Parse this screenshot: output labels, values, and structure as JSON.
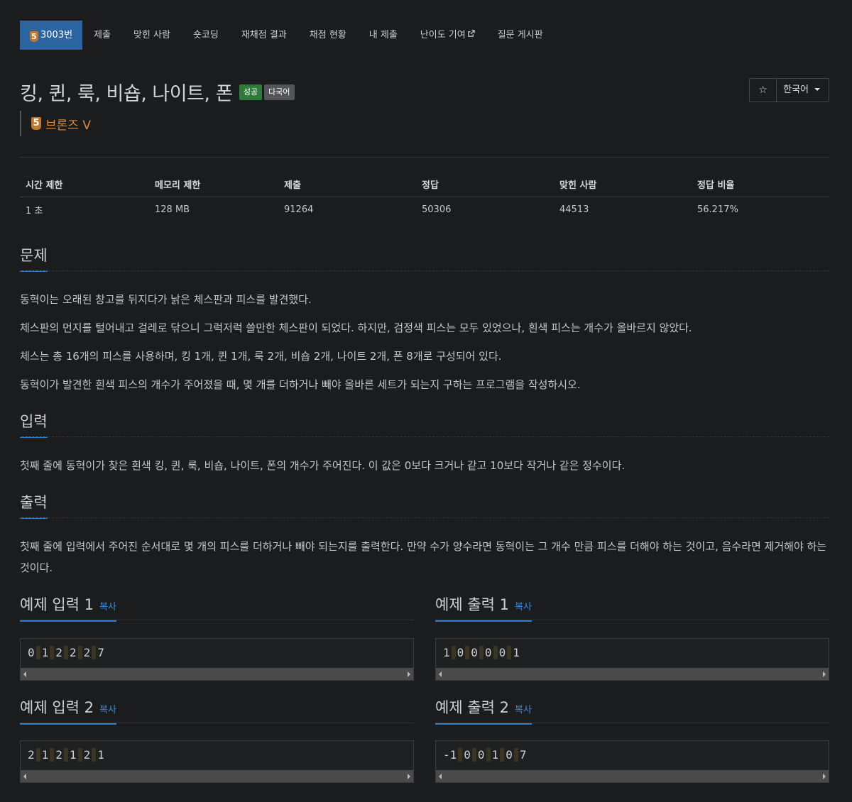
{
  "tabs": {
    "problem": {
      "tier": "5",
      "label": "3003번"
    },
    "items": [
      "제출",
      "맞힌 사람",
      "숏코딩",
      "재채점 결과",
      "채점 현황",
      "내 제출",
      "난이도 기여",
      "질문 게시판"
    ]
  },
  "title": "킹, 퀸, 룩, 비숍, 나이트, 폰",
  "labels": {
    "success": "성공",
    "multi": "다국어"
  },
  "star_icon": "star-icon",
  "language": "한국어",
  "tier": {
    "number": "5",
    "text": "브론즈 V"
  },
  "stats": {
    "headers": [
      "시간 제한",
      "메모리 제한",
      "제출",
      "정답",
      "맞힌 사람",
      "정답 비율"
    ],
    "values": [
      "1 초",
      "128 MB",
      "91264",
      "50306",
      "44513",
      "56.217%"
    ]
  },
  "sections": {
    "problem": {
      "title": "문제",
      "paragraphs": [
        "동혁이는 오래된 창고를 뒤지다가 낡은 체스판과 피스를 발견했다.",
        "체스판의 먼지를 털어내고 걸레로 닦으니 그럭저럭 쓸만한 체스판이 되었다. 하지만, 검정색 피스는 모두 있었으나, 흰색 피스는 개수가 올바르지 않았다.",
        "체스는 총 16개의 피스를 사용하며, 킹 1개, 퀸 1개, 룩 2개, 비숍 2개, 나이트 2개, 폰 8개로 구성되어 있다.",
        "동혁이가 발견한 흰색 피스의 개수가 주어졌을 때, 몇 개를 더하거나 빼야 올바른 세트가 되는지 구하는 프로그램을 작성하시오."
      ]
    },
    "input": {
      "title": "입력",
      "text": "첫째 줄에 동혁이가 찾은 흰색 킹, 퀸, 룩, 비숍, 나이트, 폰의 개수가 주어진다. 이 값은 0보다 크거나 같고 10보다 작거나 같은 정수이다."
    },
    "output": {
      "title": "출력",
      "text": "첫째 줄에 입력에서 주어진 순서대로 몇 개의 피스를 더하거나 빼야 되는지를 출력한다. 만약 수가 양수라면 동혁이는 그 개수 만큼 피스를 더해야 하는 것이고, 음수라면 제거해야 하는 것이다."
    }
  },
  "samples": {
    "copy": "복사",
    "input1": {
      "title": "예제 입력 1",
      "tokens": [
        "0",
        "1",
        "2",
        "2",
        "2",
        "7"
      ]
    },
    "output1": {
      "title": "예제 출력 1",
      "tokens": [
        "1",
        "0",
        "0",
        "0",
        "0",
        "1"
      ]
    },
    "input2": {
      "title": "예제 입력 2",
      "tokens": [
        "2",
        "1",
        "2",
        "1",
        "2",
        "1"
      ]
    },
    "output2": {
      "title": "예제 출력 2",
      "tokens": [
        "-1",
        "0",
        "0",
        "1",
        "0",
        "7"
      ]
    }
  }
}
